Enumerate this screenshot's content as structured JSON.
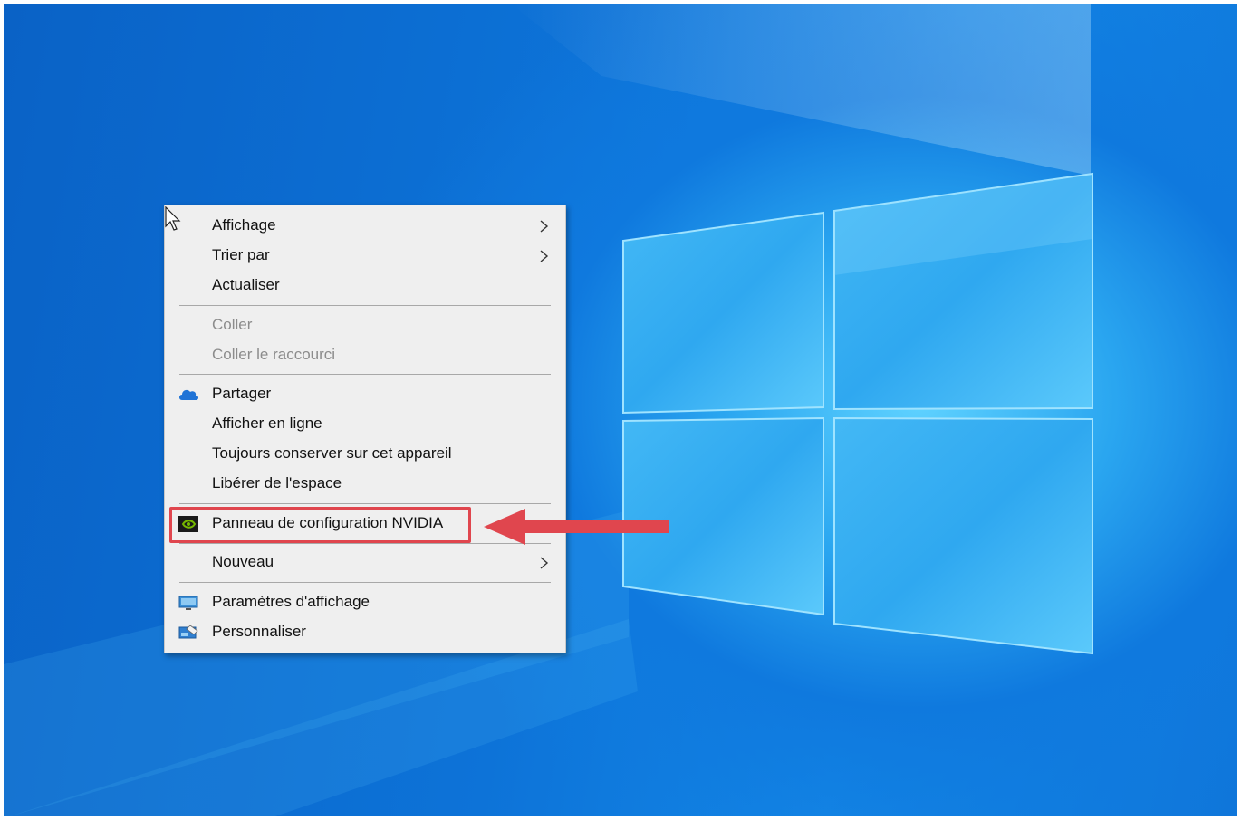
{
  "context_menu": {
    "items": [
      {
        "label": "Affichage",
        "submenu": true,
        "enabled": true
      },
      {
        "label": "Trier par",
        "submenu": true,
        "enabled": true
      },
      {
        "label": "Actualiser",
        "submenu": false,
        "enabled": true
      },
      {
        "label": "Coller",
        "submenu": false,
        "enabled": false
      },
      {
        "label": "Coller le raccourci",
        "submenu": false,
        "enabled": false
      },
      {
        "label": "Partager",
        "icon": "onedrive-cloud-icon",
        "enabled": true
      },
      {
        "label": "Afficher en ligne",
        "enabled": true
      },
      {
        "label": "Toujours conserver sur cet appareil",
        "enabled": true
      },
      {
        "label": "Libérer de l'espace",
        "enabled": true
      },
      {
        "label": "Panneau de configuration NVIDIA",
        "icon": "nvidia-icon",
        "enabled": true,
        "highlighted": true
      },
      {
        "label": "Nouveau",
        "submenu": true,
        "enabled": true
      },
      {
        "label": "Paramètres d'affichage",
        "icon": "display-settings-icon",
        "enabled": true
      },
      {
        "label": "Personnaliser",
        "icon": "personalize-icon",
        "enabled": true
      }
    ]
  },
  "annotation": {
    "color": "#e0464e",
    "arrow_direction": "left",
    "target": "Panneau de configuration NVIDIA"
  },
  "colors": {
    "desktop_blue": "#0f76da",
    "logo_glow": "#5fd2ff",
    "menu_bg": "#efefef"
  }
}
